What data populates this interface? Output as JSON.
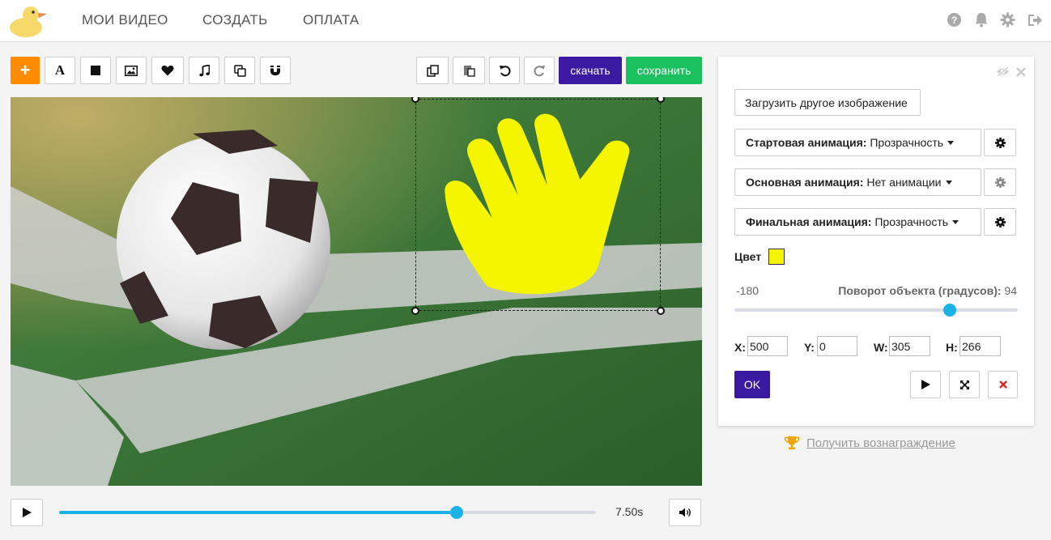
{
  "nav": {
    "items": [
      {
        "label": "МОИ ВИДЕО"
      },
      {
        "label": "СОЗДАТЬ"
      },
      {
        "label": "ОПЛАТА"
      }
    ],
    "right_icons": [
      "help-icon",
      "bell-icon",
      "gear-icon",
      "logout-icon"
    ]
  },
  "toolbar": {
    "add_label": "+",
    "text_tool_label": "A",
    "tools": [
      "text-icon",
      "square-icon",
      "image-icon",
      "heart-icon",
      "music-icon",
      "copy-icon",
      "magnet-icon"
    ],
    "right_tools": [
      "duplicate-icon",
      "paste-icon",
      "undo-icon",
      "redo-icon"
    ],
    "download_label": "скачать",
    "save_label": "сохранить"
  },
  "canvas": {
    "selected_object": "hand-icon",
    "selected_color": "#f5f500"
  },
  "player": {
    "time": "7.50s",
    "progress": 0.74
  },
  "panel": {
    "upload_label": "Загрузить другое изображение",
    "start_anim": {
      "label": "Стартовая анимация:",
      "value": "Прозрачность"
    },
    "main_anim": {
      "label": "Основная анимация:",
      "value": "Нет анимации"
    },
    "final_anim": {
      "label": "Финальная анимация:",
      "value": "Прозрачность"
    },
    "color_label": "Цвет",
    "color_value": "#f5f500",
    "rotation": {
      "min_label": "-180",
      "label": "Поворот объекта (градусов):",
      "value": "94",
      "min": -180,
      "max": 180,
      "current": 94
    },
    "x_label": "X:",
    "x_value": "500",
    "y_label": "Y:",
    "y_value": "0",
    "w_label": "W:",
    "w_value": "305",
    "h_label": "H:",
    "h_value": "266",
    "ok_label": "OK"
  },
  "reward": {
    "label": "Получить вознаграждение"
  },
  "colors": {
    "accent_orange": "#ff8c00",
    "download_purple": "#3a1aa0",
    "save_green": "#1cc15f",
    "slider_blue": "#1ab3e8"
  }
}
